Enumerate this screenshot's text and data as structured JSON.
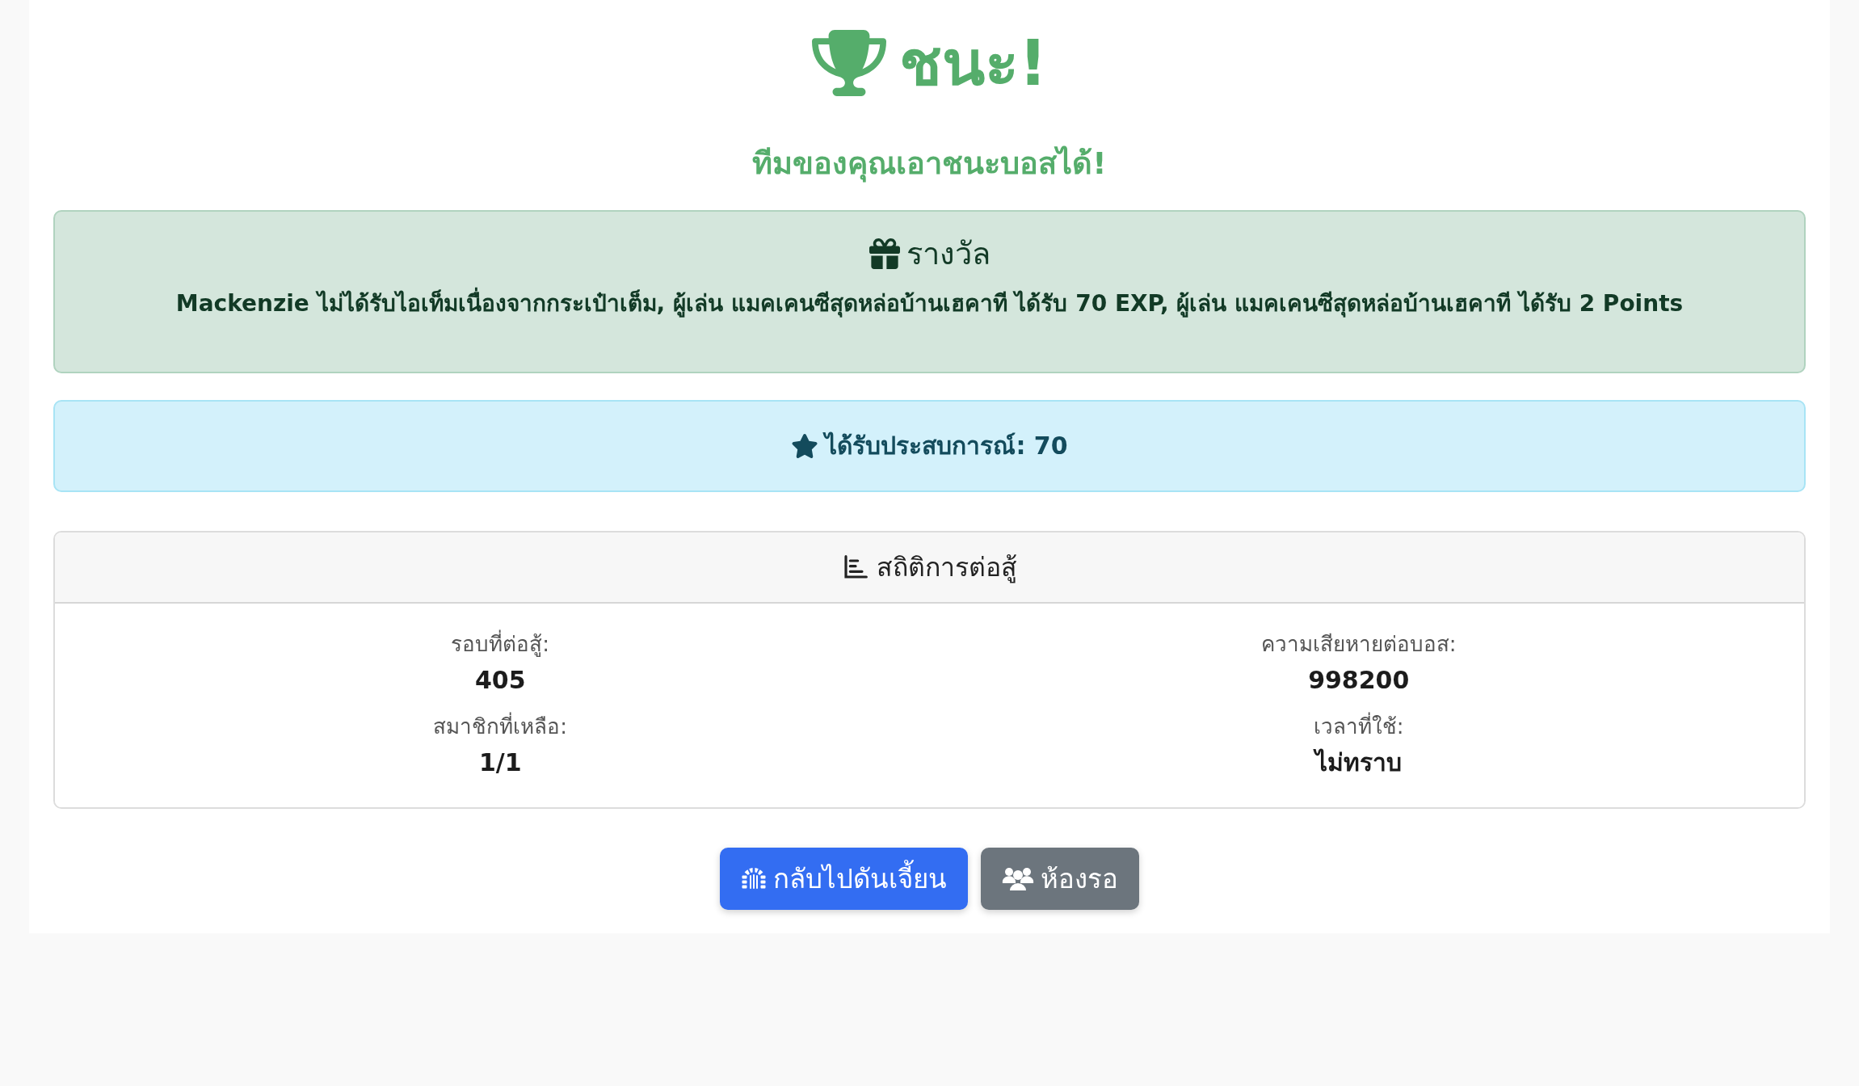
{
  "header": {
    "title": "ชนะ!",
    "subtitle": "ทีมของคุณเอาชนะบอสได้!"
  },
  "reward_alert": {
    "title": "รางวัล",
    "message": "Mackenzie ไม่ได้รับไอเท็มเนื่องจากกระเป๋าเต็ม, ผู้เล่น แมคเคนซีสุดหล่อบ้านเฮคาที ได้รับ 70 EXP, ผู้เล่น แมคเคนซีสุดหล่อบ้านเฮคาที ได้รับ 2 Points"
  },
  "experience_alert": {
    "text": "ได้รับประสบการณ์: 70"
  },
  "stats_card": {
    "title": "สถิติการต่อสู้",
    "items": [
      {
        "label": "รอบที่ต่อสู้:",
        "value": "405"
      },
      {
        "label": "ความเสียหายต่อบอส:",
        "value": "998200"
      },
      {
        "label": "สมาชิกที่เหลือ:",
        "value": "1/1"
      },
      {
        "label": "เวลาที่ใช้:",
        "value": "ไม่ทราบ"
      }
    ]
  },
  "buttons": [
    {
      "label": "กลับไปดันเจี้ยน",
      "kind": "primary"
    },
    {
      "label": "ห้องรอ",
      "kind": "secondary"
    }
  ]
}
